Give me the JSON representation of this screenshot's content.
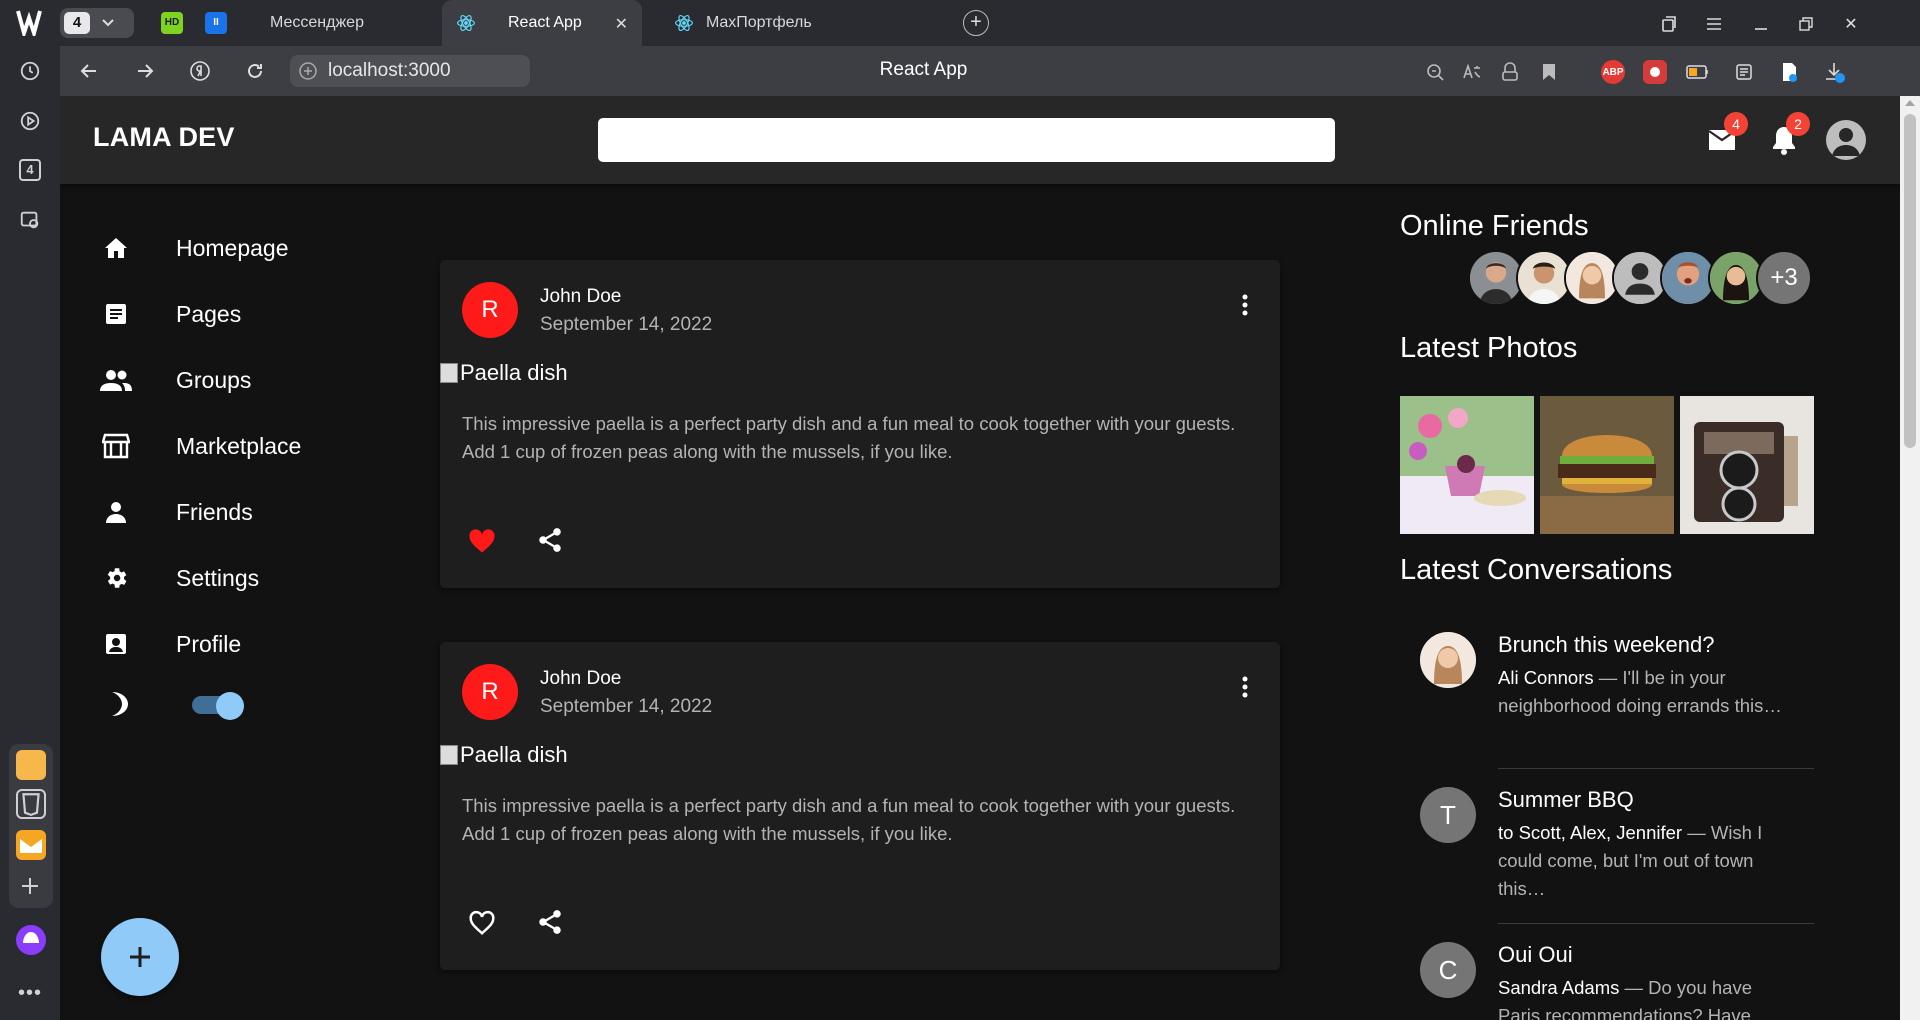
{
  "browser": {
    "tab_counter": "4",
    "rail_counter": "4",
    "tabs": [
      {
        "label": "Мессенджер"
      },
      {
        "label": "React App"
      },
      {
        "label": "MaxПортфель"
      }
    ],
    "url": "localhost:3000",
    "page_title": "React App",
    "pinned": [
      {
        "label": "HD"
      },
      {
        "label": "II"
      }
    ],
    "extensions": [
      {
        "label": "ABP"
      }
    ]
  },
  "app": {
    "brand": "LAMA DEV",
    "search": {
      "value": "",
      "placeholder": ""
    },
    "mail_badge": "4",
    "notif_badge": "2",
    "sidebar": {
      "items": [
        {
          "label": "Homepage",
          "icon": "home-icon"
        },
        {
          "label": "Pages",
          "icon": "article-icon"
        },
        {
          "label": "Groups",
          "icon": "people-icon"
        },
        {
          "label": "Marketplace",
          "icon": "storefront-icon"
        },
        {
          "label": "Friends",
          "icon": "person-icon"
        },
        {
          "label": "Settings",
          "icon": "gear-icon"
        },
        {
          "label": "Profile",
          "icon": "account-box-icon"
        }
      ],
      "dark_mode": true
    },
    "fab_label": "+",
    "posts": [
      {
        "avatar": "R",
        "author": "John Doe",
        "date": "September 14, 2022",
        "image_alt": "Paella dish",
        "text": "This impressive paella is a perfect party dish and a fun meal to cook together with your guests. Add 1 cup of frozen peas along with the mussels, if you like.",
        "liked": true
      },
      {
        "avatar": "R",
        "author": "John Doe",
        "date": "September 14, 2022",
        "image_alt": "Paella dish",
        "text": "This impressive paella is a perfect party dish and a fun meal to cook together with your guests. Add 1 cup of frozen peas along with the mussels, if you like.",
        "liked": false
      }
    ],
    "rightbar": {
      "online_heading": "Online Friends",
      "online_more": "+3",
      "photos_heading": "Latest Photos",
      "conversations_heading": "Latest Conversations",
      "conversations": [
        {
          "avatar": "",
          "title": "Brunch this weekend?",
          "who": "Ali Connors",
          "snippet": " — I'll be in your neighborhood doing errands this…"
        },
        {
          "avatar": "T",
          "title": "Summer BBQ",
          "who": "to Scott, Alex, Jennifer",
          "snippet": " — Wish I could come, but I'm out of town this…"
        },
        {
          "avatar": "C",
          "title": "Oui Oui",
          "who": "Sandra Adams",
          "snippet": " — Do you have Paris recommendations? Have"
        }
      ]
    }
  },
  "colors": {
    "background": "#121212",
    "appbar": "#272727",
    "card": "#1e1e1e",
    "accent": "#90caf9",
    "badge": "#f44336",
    "avatar_red": "#ff1a1a"
  }
}
